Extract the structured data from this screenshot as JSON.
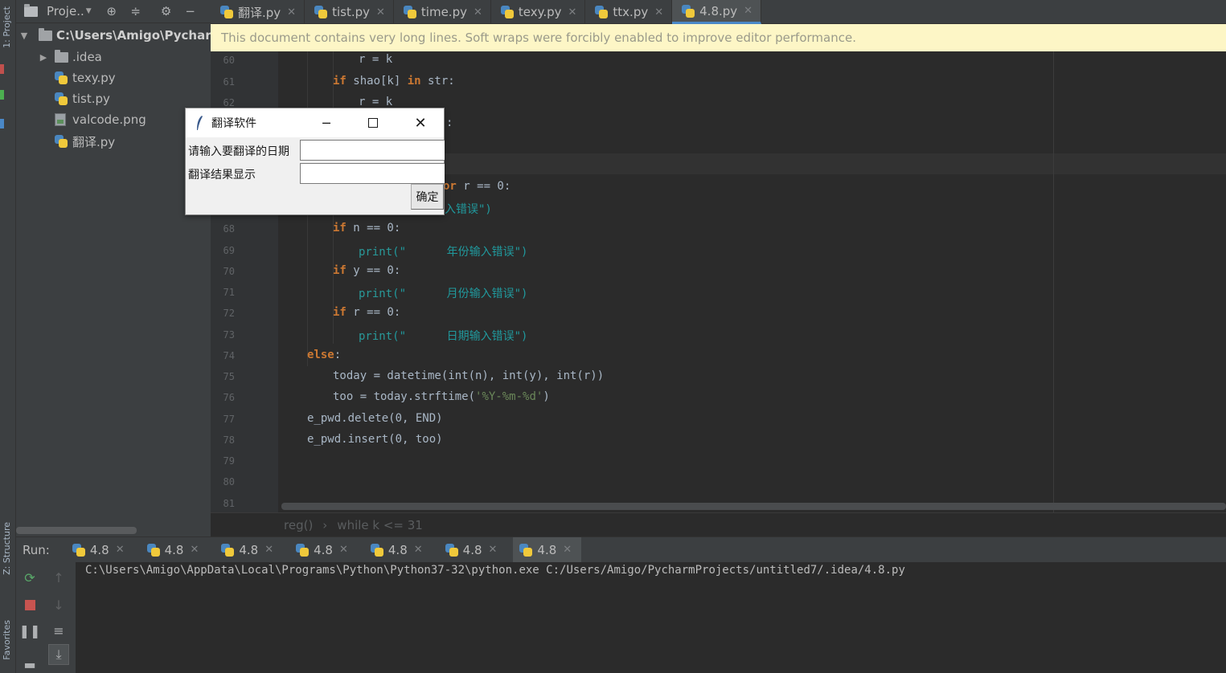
{
  "project": {
    "toolbar_title": "Proje..",
    "stripe_label": "1: Project",
    "root": "C:\\Users\\Amigo\\Pycharm",
    "items": [
      {
        "label": ".idea",
        "kind": "folder"
      },
      {
        "label": "texy.py",
        "kind": "python"
      },
      {
        "label": "tist.py",
        "kind": "python"
      },
      {
        "label": "valcode.png",
        "kind": "image"
      },
      {
        "label": "翻译.py",
        "kind": "python"
      }
    ]
  },
  "tabs": [
    {
      "label": "翻译.py",
      "active": false
    },
    {
      "label": "tist.py",
      "active": false
    },
    {
      "label": "time.py",
      "active": false
    },
    {
      "label": "texy.py",
      "active": false
    },
    {
      "label": "ttx.py",
      "active": false
    },
    {
      "label": "4.8.py",
      "active": true
    }
  ],
  "banner": "This document contains very long lines. Soft wraps were forcibly enabled to improve editor performance.",
  "editor": {
    "line_numbers": [
      "60",
      "61",
      "62",
      "68",
      "69",
      "70",
      "71",
      "72",
      "73",
      "74",
      "75",
      "76",
      "77",
      "78",
      "79",
      "80",
      "81"
    ],
    "partial": {
      "l65_tail": ":",
      "l66_kw": "or",
      "l66_rest": " r == 0:",
      "l67_str": "入错误\")"
    },
    "lines": {
      "l60": "r = k",
      "l61_kw": "if",
      "l61_a": " shao[k] ",
      "l61_in": "in",
      "l61_b": " str:",
      "l62": "r = k",
      "l68_kw": "if",
      "l68_rest": " n == 0:",
      "l69_fn": "print",
      "l69_str": "(\"      年份输入错误\")",
      "l70_kw": "if",
      "l70_rest": " y == 0:",
      "l71_fn": "print",
      "l71_str": "(\"      月份输入错误\")",
      "l72_kw": "if",
      "l72_rest": " r == 0:",
      "l73_fn": "print",
      "l73_str": "(\"      日期输入错误\")",
      "l74_kw": "else",
      "l74_rest": ":",
      "l75": "today = datetime(int(n), int(y), int(r))",
      "l76_a": "too = today.strftime(",
      "l76_str": "'%Y-%m-%d'",
      "l76_b": ")",
      "l77": "e_pwd.delete(0, END)",
      "l78": "e_pwd.insert(0, too)"
    }
  },
  "breadcrumb": {
    "func": "reg()",
    "sep": "›",
    "loop": "while k <= 31"
  },
  "run": {
    "label": "Run:",
    "tabs": [
      "4.8",
      "4.8",
      "4.8",
      "4.8",
      "4.8",
      "4.8",
      "4.8"
    ],
    "console": "C:\\Users\\Amigo\\AppData\\Local\\Programs\\Python\\Python37-32\\python.exe C:/Users/Amigo/PycharmProjects/untitled7/.idea/4.8.py"
  },
  "dialog": {
    "title": "翻译软件",
    "input_label": "请输入要翻译的日期",
    "result_label": "翻译结果显示",
    "ok_label": "确定",
    "input_value": "",
    "result_value": ""
  },
  "side_labels": {
    "structure": "Z: Structure",
    "favorites": "Favorites"
  }
}
